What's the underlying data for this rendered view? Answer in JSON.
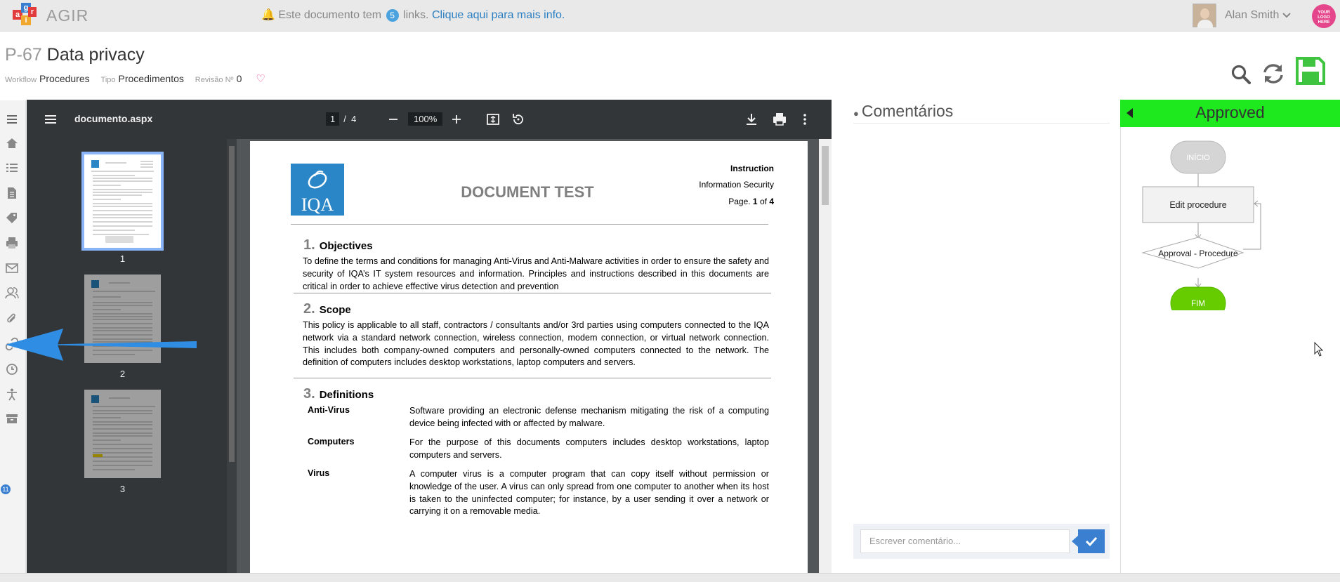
{
  "app": {
    "name": "AGIR"
  },
  "notice": {
    "prefix": "Este documento tem",
    "count": "5",
    "mid": "links.",
    "link": "Clique aqui para mais info."
  },
  "user": {
    "name": "Alan Smith",
    "logo_text": "YOUR LOGO HERE"
  },
  "document": {
    "code": "P-67",
    "title": "Data privacy",
    "workflow_label": "Workflow",
    "workflow": "Procedures",
    "type_label": "Tipo",
    "type": "Procedimentos",
    "revision_label": "Revisão Nº",
    "revision": "0"
  },
  "toolbar": {
    "icons": [
      "search-icon",
      "refresh-icon",
      "save-icon"
    ]
  },
  "rail": {
    "icons": [
      "menu-icon",
      "home-icon",
      "list-icon",
      "document-icon",
      "tag-icon",
      "print-icon",
      "mail-icon",
      "users-icon",
      "paperclip-icon",
      "link-icon",
      "clock-icon",
      "accessibility-icon",
      "archive-icon"
    ],
    "badge": "11"
  },
  "viewer": {
    "filename": "documento.aspx",
    "page_current": "1",
    "page_sep": "/",
    "page_total": "4",
    "zoom": "100%",
    "thumbs": [
      "1",
      "2",
      "3"
    ]
  },
  "pdf": {
    "logo": "IQA",
    "title": "DOCUMENT TEST",
    "header_right": [
      "Instruction",
      "Information Security"
    ],
    "page_label": "Page.",
    "page_num": "1",
    "page_of": "of",
    "page_total": "4",
    "sections": [
      {
        "num": "1.",
        "title": "Objectives",
        "text": "To define the terms and conditions for managing Anti-Virus and Anti-Malware activities in order to ensure the safety and security of IQA’s IT system resources and information. Principles and instructions described in this documents are critical in order to achieve effective virus detection and prevention"
      },
      {
        "num": "2.",
        "title": "Scope",
        "text": "This policy is applicable to all staff, contractors / consultants and/or 3rd parties using computers connected to the IQA network via a standard network connection, wireless connection, modem connection, or virtual network connection. This includes both company-owned computers and personally-owned computers connected to the network. The definition of computers includes desktop workstations, laptop computers and servers."
      },
      {
        "num": "3.",
        "title": "Definitions",
        "text": ""
      }
    ],
    "definitions": [
      {
        "term": "Anti-Virus",
        "def": "Software providing an electronic defense mechanism mitigating the risk of a computing device being infected with or affected by malware."
      },
      {
        "term": "Computers",
        "def": "For the purpose of this documents computers includes desktop workstations, laptop computers and servers."
      },
      {
        "term": "Virus",
        "def": "A computer virus is a computer program that can copy itself without permission or knowledge of the user. A virus can only spread from one computer to another when its host is taken to the uninfected computer; for instance, by a user sending it over a network or carrying it on a removable media."
      }
    ]
  },
  "comments": {
    "title": "Comentários",
    "placeholder": "Escrever comentário..."
  },
  "workflow": {
    "status": "Approved",
    "nodes": {
      "start": "INÍCIO",
      "edit": "Edit procedure",
      "approval": "Approval - Procedure",
      "end": "FIM"
    }
  },
  "colors": {
    "approved": "#1ee81e",
    "accent": "#3b7fd1",
    "fim": "#66cc00"
  }
}
